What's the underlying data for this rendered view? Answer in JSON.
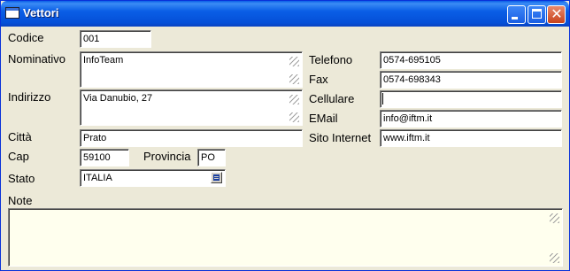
{
  "window": {
    "title": "Vettori"
  },
  "labels": {
    "codice": "Codice",
    "nominativo": "Nominativo",
    "indirizzo": "Indirizzo",
    "citta": "Città",
    "cap": "Cap",
    "provincia": "Provincia",
    "stato": "Stato",
    "note": "Note",
    "telefono": "Telefono",
    "fax": "Fax",
    "cellulare": "Cellulare",
    "email": "EMail",
    "sito": "Sito Internet"
  },
  "values": {
    "codice": "001",
    "nominativo": "InfoTeam",
    "indirizzo": "Via Danubio, 27",
    "citta": "Prato",
    "cap": "59100",
    "provincia": "PO",
    "stato": "ITALIA",
    "note": "",
    "telefono": "0574-695105",
    "fax": "0574-698343",
    "cellulare": "",
    "email": "info@iftm.it",
    "sito": "www.iftm.it"
  },
  "colors": {
    "title_bar": "#0a5ee6",
    "face": "#ece9d8",
    "note_bg": "#ffffee"
  }
}
